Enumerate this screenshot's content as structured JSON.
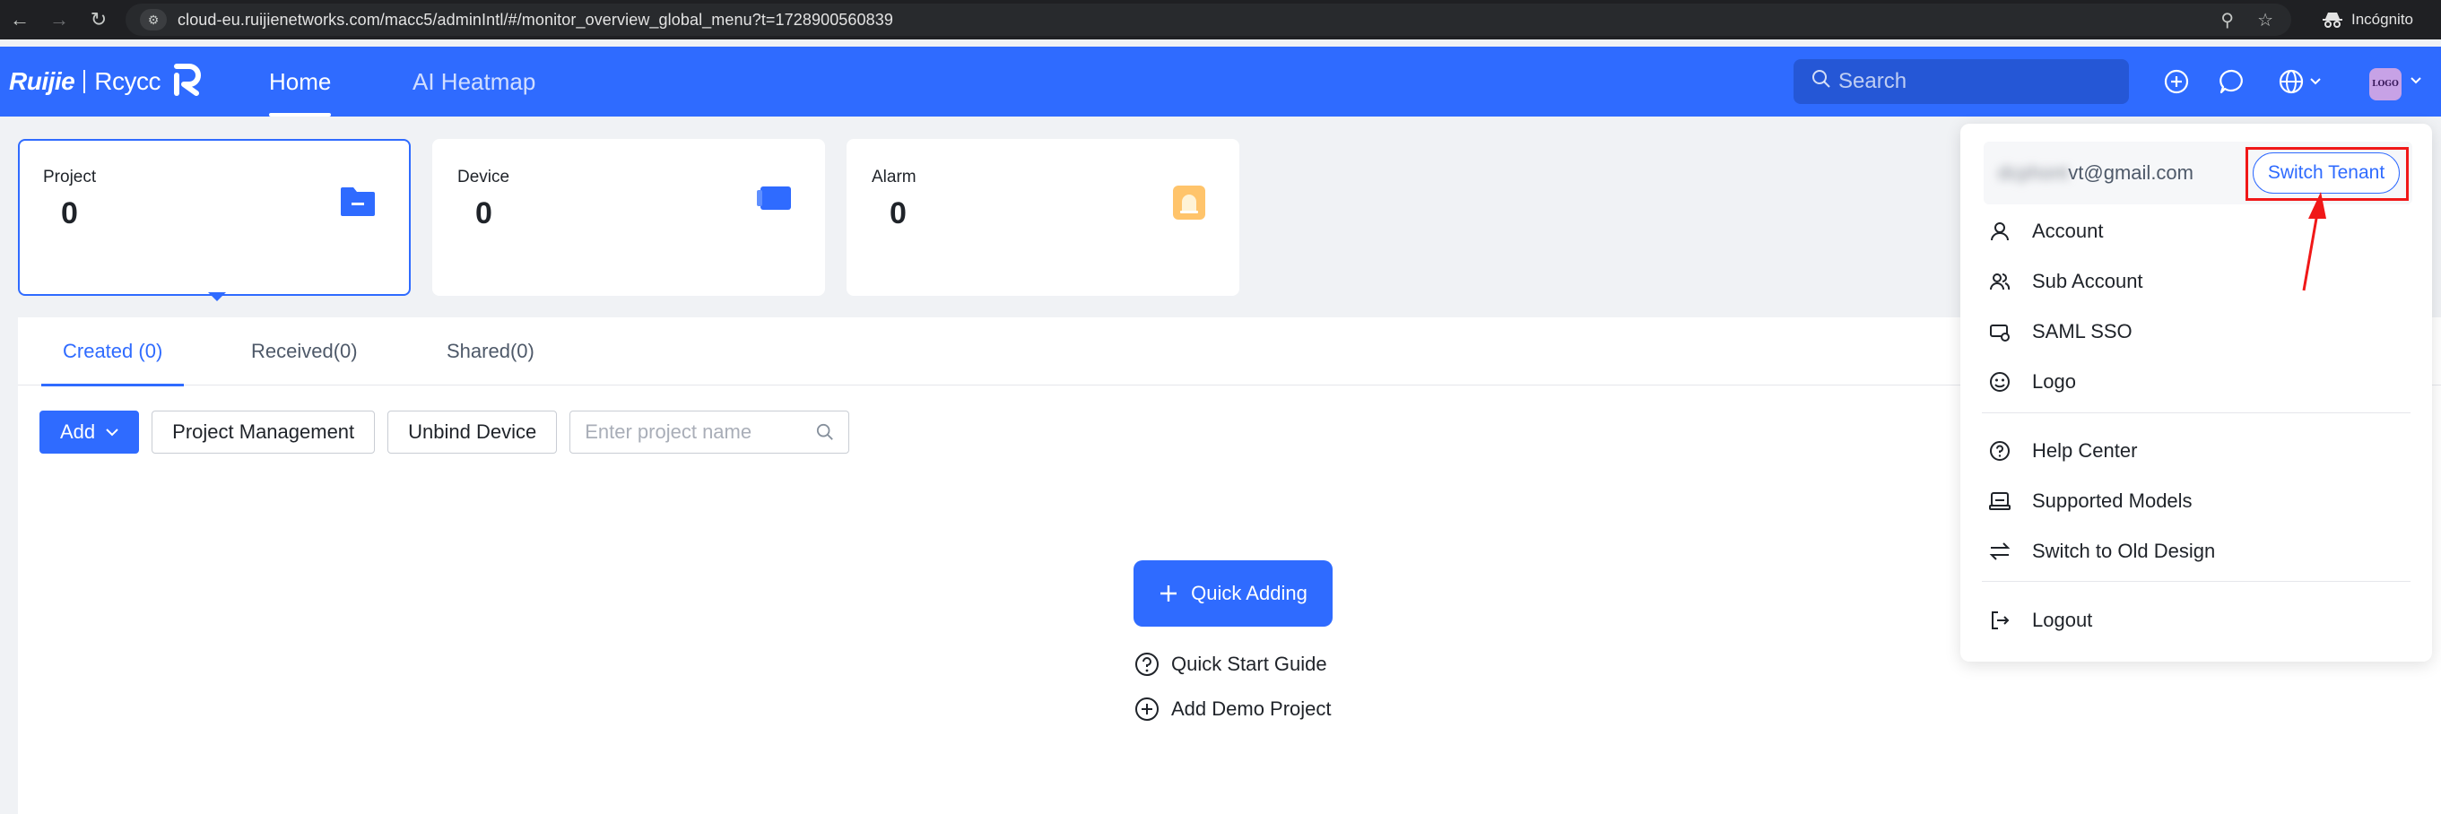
{
  "browser": {
    "url": "cloud-eu.ruijienetworks.com/macc5/adminIntl/#/monitor_overview_global_menu?t=1728900560839",
    "incognito_label": "Incógnito"
  },
  "header": {
    "brand_ruijie": "Ruijie",
    "brand_reyee": "Rcycc",
    "tabs": [
      {
        "label": "Home",
        "active": true
      },
      {
        "label": "AI Heatmap",
        "active": false
      }
    ],
    "search_placeholder": "Search",
    "avatar_text": "LOGO"
  },
  "stats": [
    {
      "label": "Project",
      "value": "0"
    },
    {
      "label": "Device",
      "value": "0"
    },
    {
      "label": "Alarm",
      "value": "0"
    }
  ],
  "subtabs": [
    {
      "label": "Created (0)"
    },
    {
      "label": "Received(0)"
    },
    {
      "label": "Shared(0)"
    }
  ],
  "toolbar": {
    "add_label": "Add",
    "project_management_label": "Project Management",
    "unbind_device_label": "Unbind Device",
    "project_search_placeholder": "Enter project name"
  },
  "empty_state": {
    "quick_adding_label": "Quick Adding",
    "quick_start_label": "Quick Start Guide",
    "demo_project_label": "Add Demo Project"
  },
  "dropdown": {
    "email_hidden": "dcphont",
    "email_visible": "vt@gmail.com",
    "switch_tenant_label": "Switch Tenant",
    "items": [
      {
        "label": "Account"
      },
      {
        "label": "Sub Account"
      },
      {
        "label": "SAML SSO"
      },
      {
        "label": "Logo"
      },
      {
        "label": "Help Center"
      },
      {
        "label": "Supported Models"
      },
      {
        "label": "Switch to Old Design"
      },
      {
        "label": "Logout"
      }
    ]
  },
  "colors": {
    "primary": "#2f6bff",
    "highlight": "#f01818"
  }
}
